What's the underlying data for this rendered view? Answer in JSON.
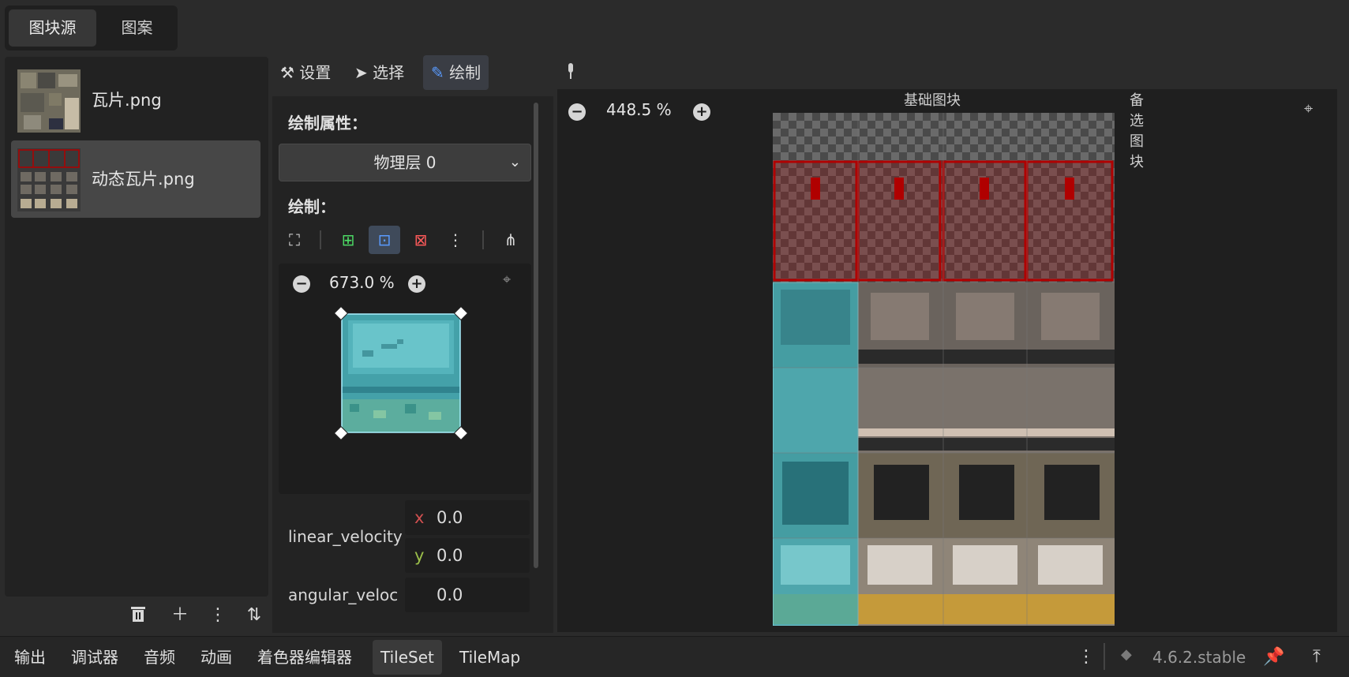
{
  "top_tabs": [
    "图块源",
    "图案"
  ],
  "sources": [
    {
      "label": "瓦片.png"
    },
    {
      "label": "动态瓦片.png"
    }
  ],
  "modes": {
    "settings": "设置",
    "select": "选择",
    "paint": "绘制"
  },
  "paint_panel": {
    "properties_title": "绘制属性：",
    "dropdown_value": "物理层 0",
    "paint_title": "绘制：",
    "preview_zoom": "673.0 %"
  },
  "properties": {
    "linear_velocity_label": "linear_velocity",
    "x_label": "x",
    "x_value": "0.0",
    "y_label": "y",
    "y_value": "0.0",
    "angular_label": "angular_veloc",
    "angular_value": "0.0"
  },
  "atlas": {
    "zoom": "448.5 %",
    "col_title_1": "基础图块",
    "col_title_2": "备选图块"
  },
  "bottom_tabs": [
    "输出",
    "调试器",
    "音频",
    "动画",
    "着色器编辑器",
    "TileSet",
    "TileMap"
  ],
  "version": "4.6.2.stable",
  "colors": {
    "accent": "#5a9bff",
    "highlight_tile": "#3aa3a6",
    "physics_red": "#b00000"
  }
}
